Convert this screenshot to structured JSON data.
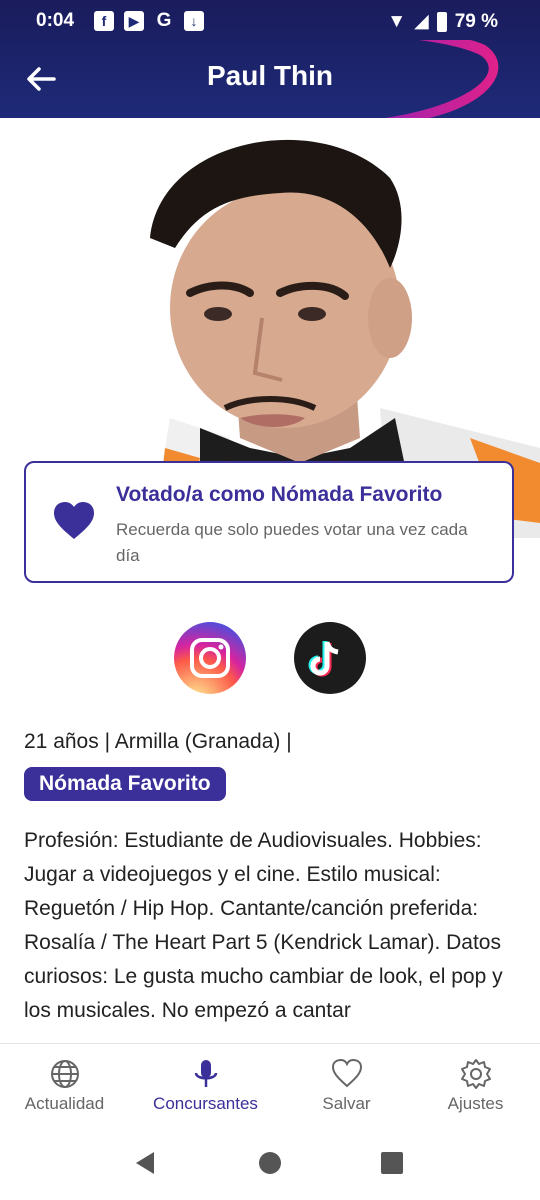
{
  "status_bar": {
    "time": "0:04",
    "battery": "79 %"
  },
  "header": {
    "title": "Paul Thin"
  },
  "vote_card": {
    "title": "Votado/a como Nómada Favorito",
    "subtitle": "Recuerda que solo puedes votar una vez cada día"
  },
  "profile": {
    "meta": "21 años | Armilla (Granada) |",
    "badge": "Nómada Favorito",
    "bio": "Profesión: Estudiante de Audiovisuales. Hobbies: Jugar a videojuegos y el cine. Estilo musical: Reguetón / Hip Hop. Cantante/canción preferida: Rosalía / The Heart Part 5 (Kendrick Lamar). Datos curiosos: Le gusta mucho cambiar de look, el pop y los musicales. No empezó a cantar"
  },
  "social": [
    "instagram-icon",
    "tiktok-icon"
  ],
  "bottom_nav": [
    {
      "label": "Actualidad",
      "icon": "globe-icon"
    },
    {
      "label": "Concursantes",
      "icon": "microphone-icon",
      "active": true
    },
    {
      "label": "Salvar",
      "icon": "heart-icon"
    },
    {
      "label": "Ajustes",
      "icon": "gear-icon"
    }
  ],
  "colors": {
    "accent": "#3b2f9a",
    "header": "#1e2a78",
    "swoosh": "#e0218a"
  }
}
